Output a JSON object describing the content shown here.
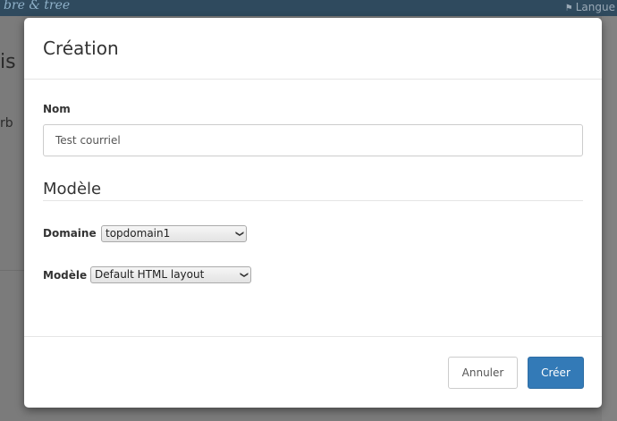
{
  "background": {
    "brand_text": "bre & tree",
    "language_label": "Langue",
    "title_fragment": "is",
    "subtitle_fragment": "rb"
  },
  "modal": {
    "title": "Création",
    "name_label": "Nom",
    "name_value": "Test courriel",
    "section_title": "Modèle",
    "domain_label": "Domaine",
    "domain_selected": "topdomain1",
    "template_label": "Modèle",
    "template_selected": "Default HTML layout",
    "cancel_label": "Annuler",
    "create_label": "Créer"
  },
  "colors": {
    "primary": "#337ab7",
    "navbar": "#2f4a5e"
  },
  "icons": {
    "language": "flag-icon",
    "select_arrow": "chevron-down-icon"
  }
}
